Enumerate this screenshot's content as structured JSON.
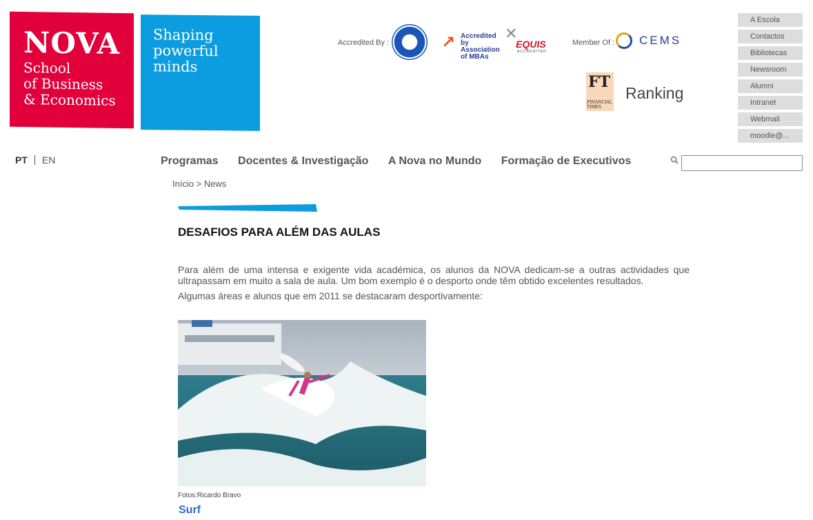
{
  "logo": {
    "name": "NOVA",
    "subtitle": "School\nof Business\n& Economics",
    "tagline": "Shaping\npowerful\nminds"
  },
  "accreditation": {
    "label": "Accredited By :",
    "amba_text": "Accredited by\nAssociation\nof MBAs",
    "equis_text": "EQUIS",
    "equis_sub": "ACCREDITED",
    "member_label": "Member Of :",
    "cems_text": "CEMS"
  },
  "ft": {
    "logo": "FT",
    "logo_sub": "FINANCIAL\nTIMES",
    "ranking": "Ranking"
  },
  "side_menu": [
    "A Escola",
    "Contactos",
    "Bibliotecas",
    "Newsroom",
    "Alumni",
    "Intranet",
    "Webmail",
    "moodle@..."
  ],
  "lang": {
    "pt": "PT",
    "en": "EN"
  },
  "nav": [
    "Programas",
    "Docentes & Investigação",
    "A Nova no Mundo",
    "Formação de Executivos"
  ],
  "search": {
    "value": ""
  },
  "breadcrumb": "Início > News",
  "article": {
    "title": "DESAFIOS PARA ALÉM DAS AULAS",
    "para1": "Para além de uma intensa e exigente vida académica, os alunos da NOVA dedicam-se a outras actividades que ultrapassam em muito a sala de aula. Um bom exemplo é o desporto onde têm obtido excelentes resultados.",
    "para2": "Algumas áreas e alunos que em 2011 se destacaram desportivamente:",
    "caption": "Fotos:Ricardo Bravo",
    "section": "Surf"
  },
  "colors": {
    "red": "#e2003c",
    "blue": "#0b9de0",
    "link": "#2b6fc9"
  }
}
